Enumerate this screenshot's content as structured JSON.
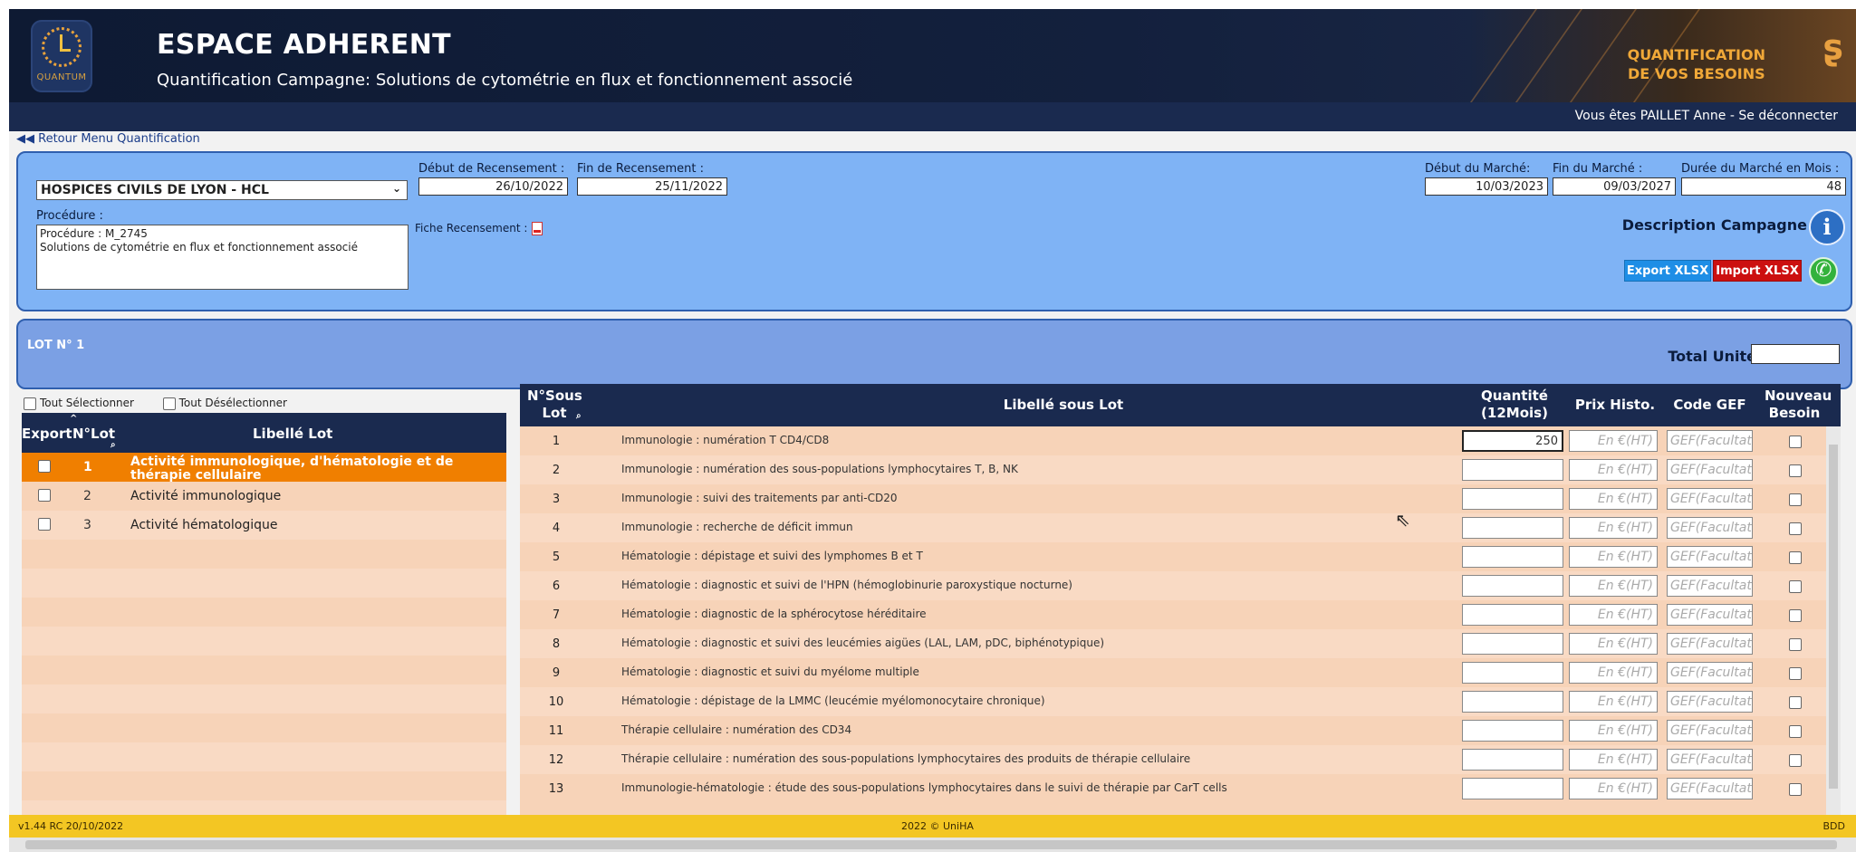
{
  "header": {
    "title": "ESPACE ADHERENT",
    "subtitle": "Quantification Campagne: Solutions de cytométrie en flux et fonctionnement associé",
    "logo_text": "QUANTUM",
    "banner_line1": "QUANTIFICATION",
    "banner_line2": "DE VOS BESOINS"
  },
  "userbar": {
    "text": "Vous êtes PAILLET Anne   - Se déconnecter"
  },
  "back_link": "◀◀ Retour Menu Quantification",
  "campaign": {
    "establishment": "HOSPICES CIVILS DE LYON - HCL",
    "debut_recensement_label": "Début de Recensement :",
    "debut_recensement": "26/10/2022",
    "fin_recensement_label": "Fin de Recensement :",
    "fin_recensement": "25/11/2022",
    "debut_marche_label": "Début du Marché:",
    "debut_marche": "10/03/2023",
    "fin_marche_label": "Fin du Marché :",
    "fin_marche": "09/03/2027",
    "duree_label": "Durée du Marché en Mois :",
    "duree": "48",
    "procedure_label": "Procédure :",
    "procedure_text": "Procédure : M_2745\nSolutions de cytométrie en flux et fonctionnement associé",
    "fiche_label": "Fiche Recensement :",
    "description_label": "Description Campagne",
    "export_label": "Export XLSX",
    "import_label": "Import XLSX"
  },
  "lot_panel": {
    "title": "LOT N° 1",
    "total_label": "Total Unité :"
  },
  "lot_table": {
    "select_all": "Tout Sélectionner",
    "deselect_all": "Tout Désélectionner",
    "headers": {
      "export": "Export",
      "num": "N°Lot",
      "label": "Libellé Lot"
    },
    "rows": [
      {
        "num": "1",
        "label": "Activité immunologique, d'hématologie et de thérapie cellulaire"
      },
      {
        "num": "2",
        "label": "Activité immunologique"
      },
      {
        "num": "3",
        "label": "Activité hématologique"
      }
    ]
  },
  "sub_table": {
    "headers": {
      "num": "N°Sous Lot",
      "label": "Libellé sous Lot",
      "qty": "Quantité (12Mois)",
      "price": "Prix Histo.",
      "gef": "Code GEF",
      "new": "Nouveau Besoin"
    },
    "price_placeholder": "En €(HT)",
    "gef_placeholder": "GEF(Facultatif)",
    "rows": [
      {
        "num": "1",
        "label": "Immunologie : numération T CD4/CD8",
        "qty": "250"
      },
      {
        "num": "2",
        "label": "Immunologie : numération des sous-populations lymphocytaires T, B, NK",
        "qty": ""
      },
      {
        "num": "3",
        "label": "Immunologie : suivi des traitements par anti-CD20",
        "qty": ""
      },
      {
        "num": "4",
        "label": "Immunologie : recherche de déficit immun",
        "qty": ""
      },
      {
        "num": "5",
        "label": "Hématologie : dépistage et suivi des lymphomes B et T",
        "qty": ""
      },
      {
        "num": "6",
        "label": "Hématologie : diagnostic et suivi de l'HPN (hémoglobinurie paroxystique nocturne)",
        "qty": ""
      },
      {
        "num": "7",
        "label": "Hématologie : diagnostic de la sphérocytose héréditaire",
        "qty": ""
      },
      {
        "num": "8",
        "label": "Hématologie : diagnostic et suivi des leucémies aigües (LAL, LAM, pDC, biphénotypique)",
        "qty": ""
      },
      {
        "num": "9",
        "label": "Hématologie : diagnostic et suivi du myélome multiple",
        "qty": ""
      },
      {
        "num": "10",
        "label": "Hématologie : dépistage de la LMMC (leucémie myélomonocytaire chronique)",
        "qty": ""
      },
      {
        "num": "11",
        "label": "Thérapie cellulaire : numération des CD34",
        "qty": ""
      },
      {
        "num": "12",
        "label": "Thérapie cellulaire : numération des sous-populations lymphocytaires des produits de thérapie cellulaire",
        "qty": ""
      },
      {
        "num": "13",
        "label": "Immunologie-hématologie : étude des sous-populations lymphocytaires dans le suivi de thérapie par CarT cells",
        "qty": ""
      }
    ]
  },
  "footer": {
    "version": "v1.44 RC 20/10/2022",
    "copyright": "2022 © UniHA",
    "env": "BDD"
  }
}
